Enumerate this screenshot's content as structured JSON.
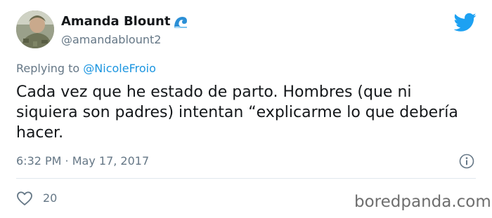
{
  "author": {
    "display_name": "Amanda Blount",
    "handle": "@amandablount2",
    "emoji_icon": "water-wave-icon"
  },
  "reply": {
    "prefix": "Replying to ",
    "mention": "@NicoleFroio"
  },
  "tweet": {
    "text": "Cada vez que he estado de parto. Hombres (que ni siquiera son padres) intentan “explicarme lo que debería hacer.",
    "timestamp": "6:32 PM · May 17, 2017"
  },
  "stats": {
    "likes": "20"
  },
  "watermark": "boredpanda.com",
  "colors": {
    "twitter_blue": "#1da1f2",
    "secondary_text": "#657786",
    "mention_blue": "#1b95e0",
    "divider": "#e1e8ed"
  }
}
